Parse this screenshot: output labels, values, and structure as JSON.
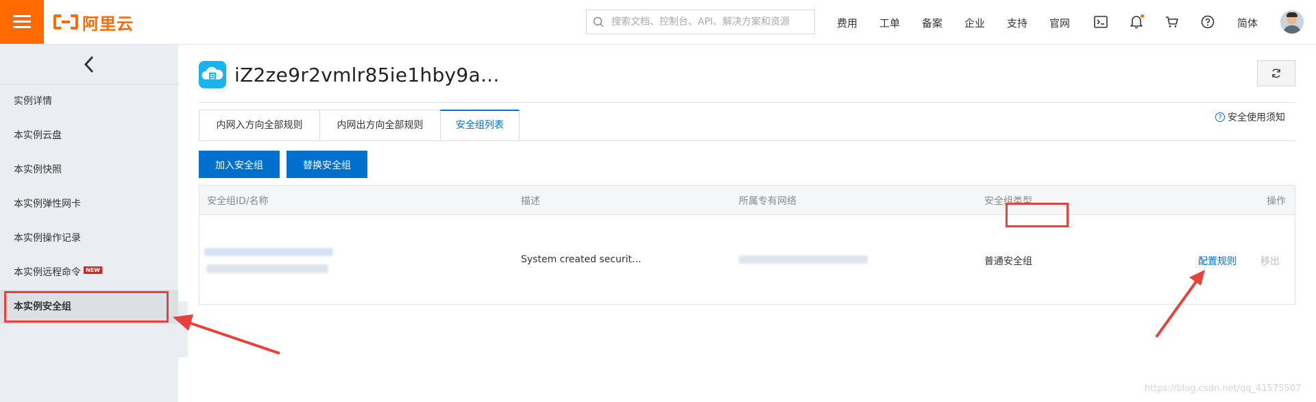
{
  "header": {
    "logo_text": "阿里云",
    "search_placeholder": "搜索文档、控制台、API、解决方案和资源",
    "nav": [
      "费用",
      "工单",
      "备案",
      "企业",
      "支持",
      "官网"
    ],
    "language": "简体",
    "icons": [
      "terminal-icon",
      "bell-icon",
      "cart-icon",
      "help-icon"
    ],
    "brand_color": "#ff6a00"
  },
  "sidebar": {
    "items": [
      {
        "label": "实例详情"
      },
      {
        "label": "本实例云盘"
      },
      {
        "label": "本实例快照"
      },
      {
        "label": "本实例弹性网卡"
      },
      {
        "label": "本实例操作记录"
      },
      {
        "label": "本实例远程命令",
        "badge": "NEW"
      },
      {
        "label": "本实例安全组",
        "active": true
      }
    ]
  },
  "main": {
    "title": "iZ2ze9r2vmlr85ie1hby9a...",
    "tabs": [
      "内网入方向全部规则",
      "内网出方向全部规则",
      "安全组列表"
    ],
    "active_tab": "安全组列表",
    "help_link": "安全使用须知",
    "buttons": {
      "join": "加入安全组",
      "replace": "替换安全组"
    },
    "table": {
      "headers": [
        "安全组ID/名称",
        "描述",
        "所属专有网络",
        "安全组类型",
        "操作"
      ],
      "rows": [
        {
          "description": "System created securit...",
          "type": "普通安全组",
          "action_configure": "配置规则",
          "action_remove": "移出"
        }
      ]
    },
    "accent_color": "#0070cc"
  },
  "watermark": "https://blog.csdn.net/qq_41575507"
}
